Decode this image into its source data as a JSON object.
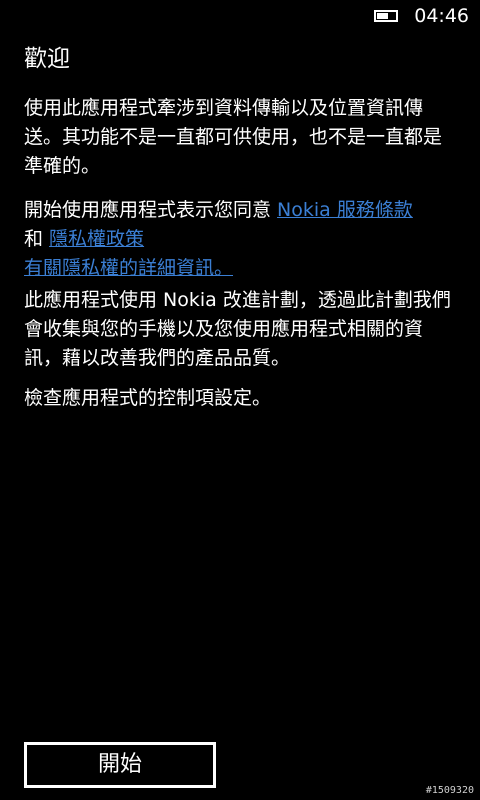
{
  "status_bar": {
    "time": "04:46",
    "battery_icon": "battery-icon",
    "battery_level": 0.6
  },
  "page": {
    "title": "歡迎",
    "intro_text": "使用此應用程式牽涉到資料傳輸以及位置資訊傳送。其功能不是一直都可供使用，也不是一直都是準確的。",
    "terms": {
      "prefix": "開始使用應用程式表示您同意 ",
      "terms_link": "Nokia 服務條款",
      "connector": "和 ",
      "privacy_link": "隱私權政策",
      "privacy_details_link": "有關隱私權的詳細資訊。"
    },
    "improvement_text": "此應用程式使用 Nokia 改進計劃，透過此計劃我們會收集與您的手機以及您使用應用程式相關的資訊，藉以改善我們的產品品質。",
    "check_text": "檢查應用程式的控制項設定。"
  },
  "actions": {
    "start_label": "開始"
  },
  "watermark": "#1509320",
  "colors": {
    "background": "#000000",
    "text": "#ffffff",
    "link": "#3b7fd4"
  }
}
